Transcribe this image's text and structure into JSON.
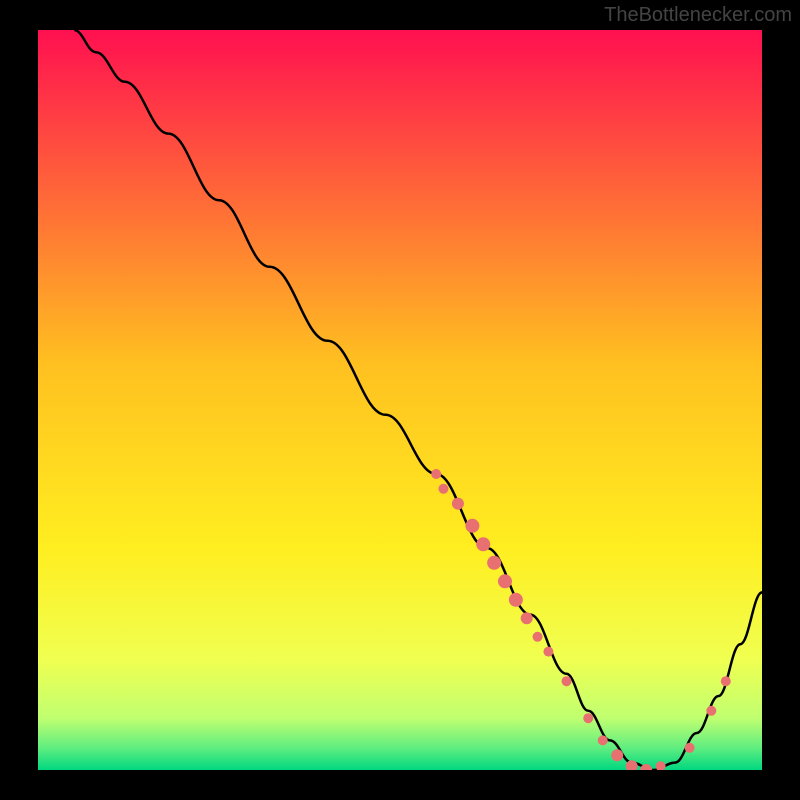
{
  "watermark": "TheBottlenecker.com",
  "chart_data": {
    "type": "line",
    "title": "",
    "xlabel": "",
    "ylabel": "",
    "xlim": [
      0,
      100
    ],
    "ylim": [
      0,
      100
    ],
    "gradient_stops": [
      {
        "offset": 0,
        "color": "#ff1050"
      },
      {
        "offset": 0.45,
        "color": "#ffc020"
      },
      {
        "offset": 0.7,
        "color": "#ffee20"
      },
      {
        "offset": 0.85,
        "color": "#f0ff50"
      },
      {
        "offset": 0.93,
        "color": "#c0ff70"
      },
      {
        "offset": 0.97,
        "color": "#60ee80"
      },
      {
        "offset": 1.0,
        "color": "#00d880"
      }
    ],
    "series": [
      {
        "name": "curve",
        "color": "#000000",
        "x": [
          5,
          8,
          12,
          18,
          25,
          32,
          40,
          48,
          55,
          62,
          68,
          73,
          76,
          79,
          82,
          85,
          88,
          91,
          94,
          97,
          100
        ],
        "y": [
          100,
          97,
          93,
          86,
          77,
          68,
          58,
          48,
          40,
          30,
          21,
          13,
          8,
          4,
          1,
          0,
          1,
          5,
          10,
          17,
          24
        ]
      }
    ],
    "markers": [
      {
        "x": 55,
        "y": 40,
        "r": 5
      },
      {
        "x": 56,
        "y": 38,
        "r": 5
      },
      {
        "x": 58,
        "y": 36,
        "r": 6
      },
      {
        "x": 60,
        "y": 33,
        "r": 7
      },
      {
        "x": 61.5,
        "y": 30.5,
        "r": 7
      },
      {
        "x": 63,
        "y": 28,
        "r": 7
      },
      {
        "x": 64.5,
        "y": 25.5,
        "r": 7
      },
      {
        "x": 66,
        "y": 23,
        "r": 7
      },
      {
        "x": 67.5,
        "y": 20.5,
        "r": 6
      },
      {
        "x": 69,
        "y": 18,
        "r": 5
      },
      {
        "x": 70.5,
        "y": 16,
        "r": 5
      },
      {
        "x": 73,
        "y": 12,
        "r": 5
      },
      {
        "x": 76,
        "y": 7,
        "r": 5
      },
      {
        "x": 78,
        "y": 4,
        "r": 5
      },
      {
        "x": 80,
        "y": 2,
        "r": 6
      },
      {
        "x": 82,
        "y": 0.5,
        "r": 6
      },
      {
        "x": 84,
        "y": 0,
        "r": 6
      },
      {
        "x": 86,
        "y": 0.5,
        "r": 5
      },
      {
        "x": 90,
        "y": 3,
        "r": 5
      },
      {
        "x": 93,
        "y": 8,
        "r": 5
      },
      {
        "x": 95,
        "y": 12,
        "r": 5
      }
    ],
    "marker_color": "#e87070"
  }
}
